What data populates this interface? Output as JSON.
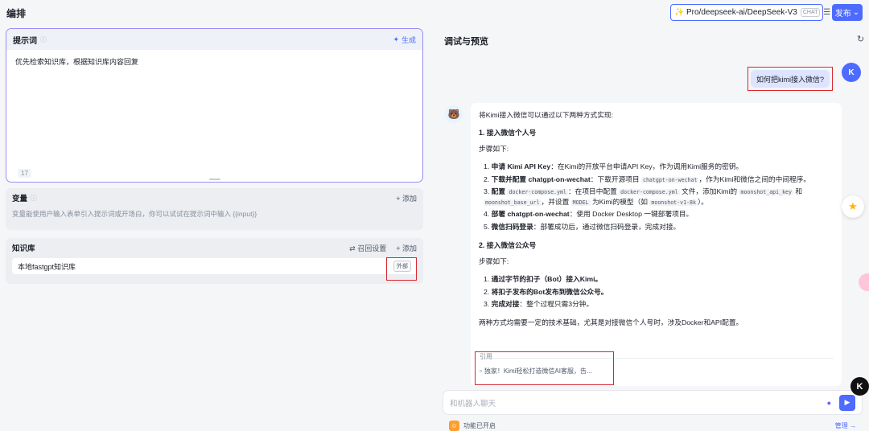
{
  "header": {
    "title": "编排",
    "model_name": "Pro/deepseek-ai/DeepSeek-V3",
    "model_tag": "CHAT",
    "publish_label": "发布"
  },
  "prompt": {
    "label": "提示词",
    "generate_label": "生成",
    "text": "优先检索知识库，根据知识库内容回复",
    "count": "17"
  },
  "variables": {
    "label": "变量",
    "add_label": "+ 添加",
    "description": "变量能使用户输入表单引入提示词或开场白，你可以试试在提示词中输入 {{input}}"
  },
  "knowledge": {
    "label": "知识库",
    "recall_label": "召回设置",
    "add_label": "+ 添加",
    "items": [
      {
        "name": "本地fastgpt知识库",
        "tag": "外部"
      }
    ]
  },
  "debug": {
    "title": "调试与预览",
    "user_avatar": "K",
    "user_message": "如何把kimi接入微信?",
    "answer": {
      "intro": "将Kimi接入微信可以通过以下两种方式实现:",
      "s1_title": "1. 接入微信个人号",
      "s1_steps_label": "步骤如下:",
      "s1_steps": [
        {
          "num": "1.",
          "bold": "申请 Kimi API Key",
          "text": "：在Kimi的开放平台申请API Key，作为调用Kimi服务的密钥。"
        },
        {
          "num": "2.",
          "bold": "下载并配置 chatgpt-on-wechat",
          "text_a": "：下载开源项目 ",
          "code": "chatgpt-on-wechat",
          "text_b": "，作为Kimi和微信之间的中间程序。"
        },
        {
          "num": "3.",
          "bold": "配置",
          "code1": "docker-compose.yml",
          "text_a": "：在项目中配置 ",
          "code2": "docker-compose.yml",
          "text_b": " 文件，添加Kimi的 ",
          "code3": "moonshot_api_key",
          "text_c": " 和 ",
          "code4": "moonshot_base_url",
          "text_d": "，并设置 ",
          "code5": "MODEL",
          "text_e": " 为Kimi的模型（如 ",
          "code6": "moonshot-v1-8k",
          "text_f": "）。"
        },
        {
          "num": "4.",
          "bold": "部署 chatgpt-on-wechat",
          "text": "：使用 Docker Desktop 一键部署项目。"
        },
        {
          "num": "5.",
          "bold": "微信扫码登录",
          "text": "：部署成功后，通过微信扫码登录，完成对接。"
        }
      ],
      "s2_title": "2. 接入微信公众号",
      "s2_steps_label": "步骤如下:",
      "s2_steps": [
        {
          "num": "1.",
          "bold": "通过字节的扣子（Bot）接入Kimi。",
          "text": ""
        },
        {
          "num": "2.",
          "bold": "将扣子发布的Bot发布到微信公众号。",
          "text": ""
        },
        {
          "num": "3.",
          "bold": "完成对接",
          "text": "：整个过程只需3分钟。"
        }
      ],
      "summary": "两种方式均需要一定的技术基础，尤其是对接微信个人号时，涉及Docker和API配置。",
      "cite_label": "引用",
      "cite_item": "独家！Kimi轻松打造微信AI客服，告..."
    },
    "input_placeholder": "和机器人聊天",
    "feature_text": "功能已开启",
    "manage_label": "管理 →"
  },
  "floating": {
    "k_logo": "K"
  }
}
